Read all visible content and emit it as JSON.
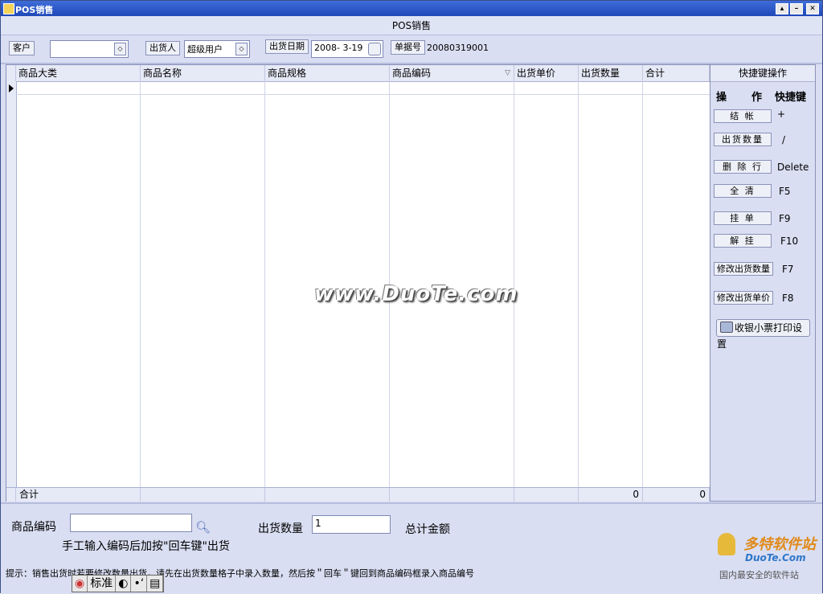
{
  "window": {
    "title": "POS销售",
    "subtitle": "POS销售"
  },
  "toolbar": {
    "customer_label": "客户",
    "customer_value": "",
    "shipper_label": "出货人",
    "shipper_value": "超级用户",
    "date_label": "出货日期",
    "date_value": "2008- 3-19",
    "docno_label": "单据号",
    "docno_value": "20080319001"
  },
  "grid": {
    "columns": [
      "商品大类",
      "商品名称",
      "商品规格",
      "商品编码",
      "出货单价",
      "出货数量",
      "合计"
    ],
    "footer_label": "合计",
    "footer_qty": "0",
    "footer_total": "0"
  },
  "side": {
    "title": "快捷键操作",
    "col_op": "操",
    "col_op2": "作",
    "col_key": "快捷键",
    "items": [
      {
        "label": "结  帐",
        "key": "+"
      },
      {
        "label": "出货数量",
        "key": "/"
      },
      {
        "label": "删 除 行",
        "key": "Delete"
      },
      {
        "label": "全  清",
        "key": "F5"
      },
      {
        "label": "挂  单",
        "key": "F9"
      },
      {
        "label": "解  挂",
        "key": "F10"
      },
      {
        "label": "修改出货数量",
        "key": "F7"
      },
      {
        "label": "修改出货单价",
        "key": "F8"
      }
    ],
    "print_label": "收银小票打印设置"
  },
  "bottom": {
    "code_label": "商品编码",
    "code_value": "",
    "qty_label": "出货数量",
    "qty_value": "1",
    "total_label": "总计金额",
    "hint_manual": "手工输入编码后加按\"回车键\"出货",
    "tip": "提示：销售出货时若要修改数量出货，请先在出货数量格子中录入数量，然后按＂回车＂键回到商品编码框录入商品编号"
  },
  "watermark": "www.DuoTe.com",
  "ime": {
    "mode": "标准"
  },
  "logo": {
    "name": "多特软件站",
    "domain": "DuoTe.Com",
    "slogan": "国内最安全的软件站"
  }
}
